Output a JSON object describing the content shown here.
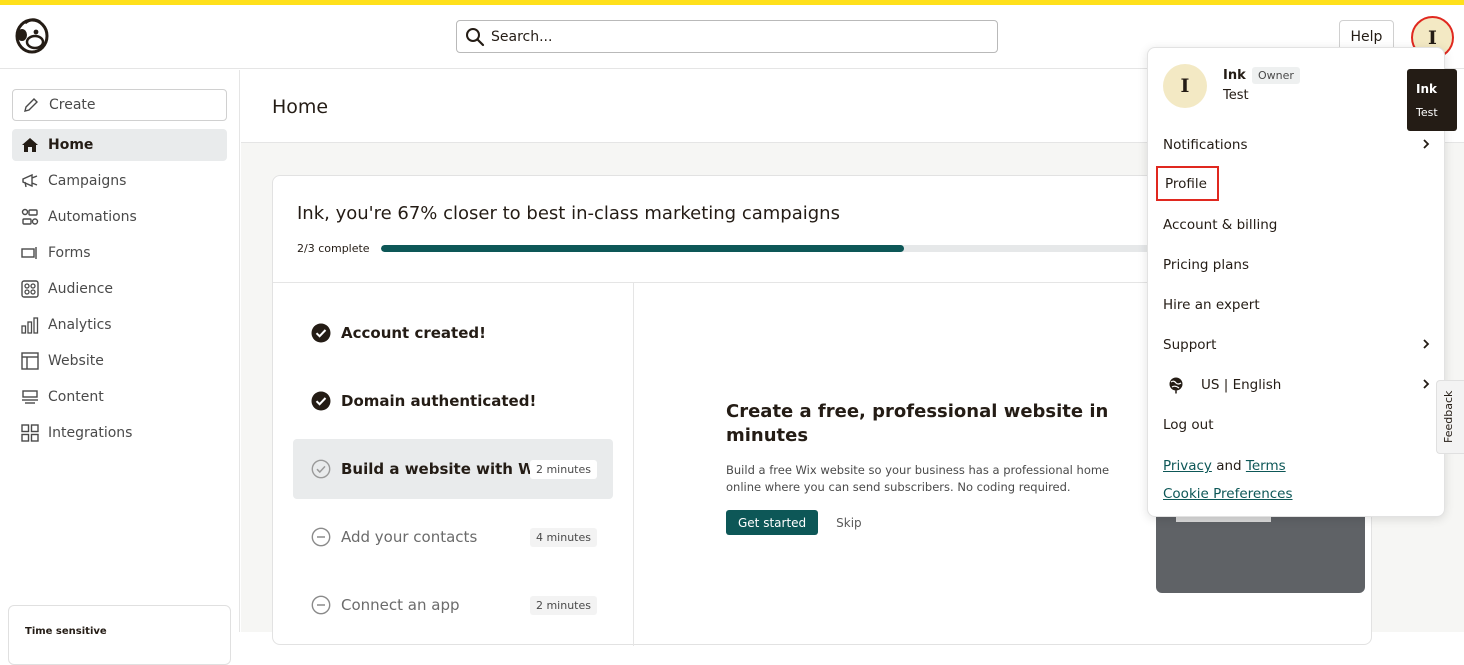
{
  "topbar": {
    "search_placeholder": "Search...",
    "help_label": "Help",
    "avatar_initial": "I"
  },
  "sidebar": {
    "create_label": "Create",
    "items": [
      {
        "label": "Home",
        "icon": "home-icon",
        "active": true
      },
      {
        "label": "Campaigns",
        "icon": "megaphone-icon"
      },
      {
        "label": "Automations",
        "icon": "automation-icon"
      },
      {
        "label": "Forms",
        "icon": "form-icon"
      },
      {
        "label": "Audience",
        "icon": "audience-icon"
      },
      {
        "label": "Analytics",
        "icon": "bar-chart-icon"
      },
      {
        "label": "Website",
        "icon": "website-icon"
      },
      {
        "label": "Content",
        "icon": "content-icon"
      },
      {
        "label": "Integrations",
        "icon": "grid-icon"
      }
    ],
    "time_card_label": "Time sensitive"
  },
  "main": {
    "page_title": "Home",
    "card": {
      "title": "Ink, you're 67% closer to best in-class marketing campaigns",
      "progress_label": "2/3 complete",
      "progress_fraction": 0.67,
      "steps": [
        {
          "label": "Account created!",
          "status": "done"
        },
        {
          "label": "Domain authenticated!",
          "status": "done"
        },
        {
          "label": "Build a website with Wix",
          "status": "current",
          "badge": "2 minutes"
        },
        {
          "label": "Add your contacts",
          "status": "todo",
          "badge": "4 minutes"
        },
        {
          "label": "Connect an app",
          "status": "todo",
          "badge": "2 minutes"
        }
      ],
      "detail": {
        "title": "Create a free, professional website in minutes",
        "body": "Build a free Wix website so your business has a professional home online where you can send subscribers. No coding required.",
        "primary_label": "Get started",
        "skip_label": "Skip"
      }
    }
  },
  "account_menu": {
    "avatar_initial": "I",
    "name": "Ink",
    "role": "Owner",
    "subtitle": "Test",
    "items": [
      {
        "label": "Notifications",
        "has_submenu": true
      },
      {
        "label": "Profile",
        "highlighted": true
      },
      {
        "label": "Account & billing"
      },
      {
        "label": "Pricing plans"
      },
      {
        "label": "Hire an expert"
      },
      {
        "label": "Support",
        "has_submenu": true
      },
      {
        "label": "US | English",
        "has_submenu": true,
        "icon": "globe-icon"
      },
      {
        "label": "Log out"
      }
    ],
    "privacy_label": "Privacy",
    "and_label": "and",
    "terms_label": "Terms",
    "cookie_label": "Cookie Preferences"
  },
  "tooltip": {
    "name": "Ink",
    "subtitle": "Test"
  },
  "feedback_label": "Feedback",
  "colors": {
    "brand_yellow": "#ffe01b",
    "accent_teal": "#0d5757",
    "highlight_red": "#e0281f",
    "dark": "#241c15"
  }
}
